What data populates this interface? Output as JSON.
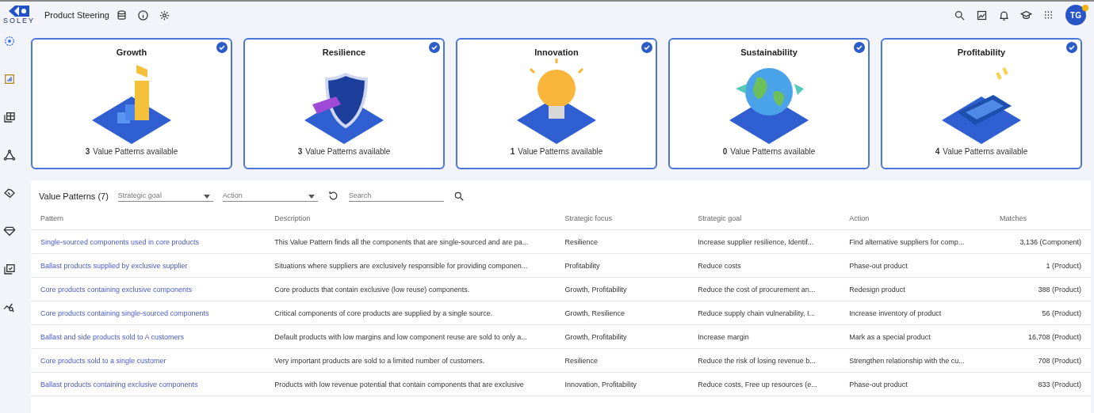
{
  "header": {
    "logo_text": "SOLEY",
    "title": "Product Steering",
    "avatar": "TG",
    "avatar_badge": true
  },
  "cards": [
    {
      "title": "Growth",
      "count": "3",
      "caption": "Value Patterns available",
      "checked": true,
      "kind": "stairs"
    },
    {
      "title": "Resilience",
      "count": "3",
      "caption": "Value Patterns available",
      "checked": true,
      "kind": "shield"
    },
    {
      "title": "Innovation",
      "count": "1",
      "caption": "Value Patterns available",
      "checked": true,
      "kind": "bulb"
    },
    {
      "title": "Sustainability",
      "count": "0",
      "caption": "Value Patterns available",
      "checked": true,
      "kind": "globe"
    },
    {
      "title": "Profitability",
      "count": "4",
      "caption": "Value Patterns available",
      "checked": true,
      "kind": "calculator"
    }
  ],
  "table": {
    "title": "Value Patterns (7)",
    "filters": [
      {
        "placeholder": "Strategic goal"
      },
      {
        "placeholder": "Action"
      }
    ],
    "search": {
      "placeholder": "Search"
    },
    "columns": [
      "Pattern",
      "Description",
      "Strategic focus",
      "Strategic goal",
      "Action",
      "Matches"
    ],
    "rows": [
      [
        "Single-sourced components used in core products",
        "This Value Pattern finds all the components that are single-sourced and are pa...",
        "Resilience",
        "Increase supplier resilience, Identif...",
        "Find alternative suppliers for comp...",
        "3,136 (Component)"
      ],
      [
        "Ballast products supplied by exclusive supplier",
        "Situations where suppliers are exclusively responsible for providing componen...",
        "Profitability",
        "Reduce costs",
        "Phase-out product",
        "1 (Product)"
      ],
      [
        "Core products containing exclusive components",
        "Core products that contain exclusive (low reuse) components.",
        "Growth, Profitability",
        "Reduce the cost of procurement an...",
        "Redesign product",
        "388 (Product)"
      ],
      [
        "Core products containing single-sourced components",
        "Critical components of core products are supplied by a single source.",
        "Growth, Resilience",
        "Reduce supply chain vulnerability, I...",
        "Increase inventory of product",
        "56 (Product)"
      ],
      [
        "Ballast and side products sold to A customers",
        "Default products with low margins and low component reuse are sold to only a...",
        "Growth, Profitability",
        "Increase margin",
        "Mark as a special product",
        "16,708 (Product)"
      ],
      [
        "Core products sold to a single customer",
        "Very important products are sold to a limited number of customers.",
        "Resilience",
        "Reduce the risk of losing revenue b...",
        "Strengthen relationship with the cu...",
        "708 (Product)"
      ],
      [
        "Ballast products containing exclusive components",
        "Products with low revenue potential that contain components that are exclusive",
        "Innovation, Profitability",
        "Reduce costs, Free up resources (e...",
        "Phase-out product",
        "833 (Product)"
      ]
    ]
  }
}
